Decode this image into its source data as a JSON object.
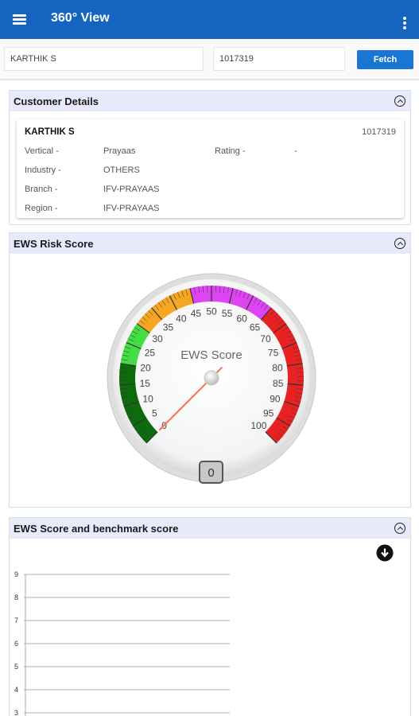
{
  "app": {
    "title": "360° View"
  },
  "search": {
    "name_value": "KARTHIK S",
    "id_value": "1017319",
    "fetch_label": "Fetch"
  },
  "customer": {
    "panel_title": "Customer Details",
    "name": "KARTHIK S",
    "id": "1017319",
    "fields": [
      {
        "label": "Vertical -",
        "value": "Prayaas"
      },
      {
        "label": "Rating -",
        "value": "-"
      },
      {
        "label": "Industry -",
        "value": "OTHERS"
      },
      {
        "label": "Branch -",
        "value": "IFV-PRAYAAS"
      },
      {
        "label": "Region -",
        "value": "IFV-PRAYAAS"
      }
    ]
  },
  "ews_risk": {
    "panel_title": "EWS Risk Score",
    "gauge": {
      "title": "EWS Score",
      "min": 0,
      "max": 100,
      "value": 0,
      "value_label": "0",
      "tick_labels": [
        "0",
        "5",
        "10",
        "15",
        "20",
        "25",
        "30",
        "35",
        "40",
        "45",
        "50",
        "55",
        "60",
        "65",
        "70",
        "75",
        "80",
        "85",
        "90",
        "95",
        "100"
      ],
      "bands": [
        {
          "from": 0,
          "to": 20,
          "color": "#0d6b0d"
        },
        {
          "from": 20,
          "to": 30,
          "color": "#44dd44"
        },
        {
          "from": 30,
          "to": 45,
          "color": "#f5a623"
        },
        {
          "from": 45,
          "to": 65,
          "color": "#dd44f2"
        },
        {
          "from": 65,
          "to": 100,
          "color": "#e82222"
        }
      ]
    }
  },
  "benchmark": {
    "panel_title": "EWS Score and benchmark score",
    "download_icon": "download-icon"
  },
  "chart_data": {
    "type": "line",
    "title": "",
    "ylim": [
      3,
      9
    ],
    "y_ticks": [
      "9",
      "8",
      "7",
      "6",
      "5",
      "4",
      "3"
    ],
    "grid": true,
    "series": []
  }
}
